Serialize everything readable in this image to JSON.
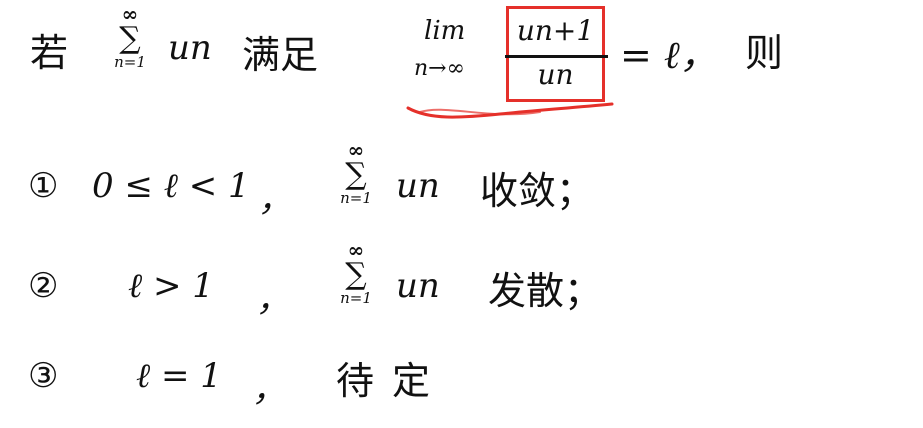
{
  "line1": {
    "ruo": "若",
    "sum_top": "∞",
    "sum_symbol": "∑",
    "sum_bottom": "n=1",
    "term": "un",
    "satisfy": "满足",
    "lim": "lim",
    "lim_sub": "n→∞",
    "numerator": "un+1",
    "denominator": "un",
    "equals_rest": "= ℓ，",
    "then": "则"
  },
  "items": [
    {
      "marker": "①",
      "condition": "0 ≤ ℓ < 1",
      "comma": "，",
      "sum_top": "∞",
      "sum_symbol": "∑",
      "sum_bottom": "n=1",
      "term": "un",
      "conclusion": "收敛；"
    },
    {
      "marker": "②",
      "condition": "ℓ > 1",
      "comma": "，",
      "sum_top": "∞",
      "sum_symbol": "∑",
      "sum_bottom": "n=1",
      "term": "un",
      "conclusion": "发散；"
    },
    {
      "marker": "③",
      "condition": "ℓ = 1",
      "comma": "，",
      "conclusion": "待定"
    }
  ],
  "colors": {
    "ink": "#111111",
    "highlight": "#e5302a"
  }
}
